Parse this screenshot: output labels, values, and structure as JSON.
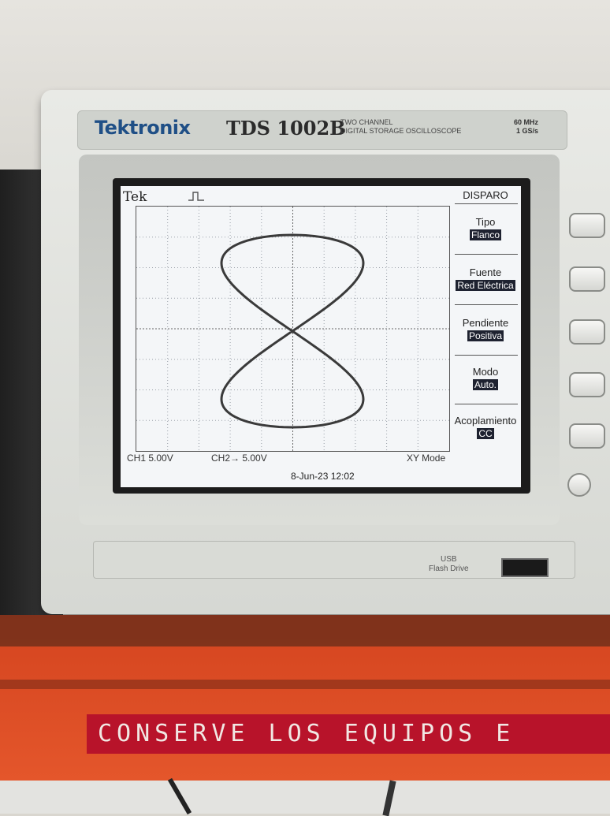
{
  "device": {
    "brand": "Tektronix",
    "model": "TDS 1002B",
    "description_line1": "TWO CHANNEL",
    "description_line2": "DIGITAL STORAGE OSCILLOSCOPE",
    "bandwidth": "60 MHz",
    "sample_rate": "1 GS/s"
  },
  "screen": {
    "logo": "Tek",
    "ch1_readout": "CH1  5.00V",
    "ch2_readout": "CH2→ 5.00V",
    "mode": "XY Mode",
    "timestamp": "8-Jun-23 12:02",
    "trace_shape": "figure-eight (Lissajous 1:2)"
  },
  "menu": {
    "title": "DISPARO",
    "items": [
      {
        "label": "Tipo",
        "value": "Flanco"
      },
      {
        "label": "Fuente",
        "value": "Red Eléctrica"
      },
      {
        "label": "Pendiente",
        "value": "Positiva"
      },
      {
        "label": "Modo",
        "value": "Auto."
      },
      {
        "label": "Acoplamiento",
        "value": "CC"
      }
    ]
  },
  "panel": {
    "usb_line1": "USB",
    "usb_line2": "Flash Drive"
  },
  "shelf": {
    "label_text": "CONSERVE LOS EQUIPOS E"
  },
  "colors": {
    "brand_blue": "#1f4f86",
    "screen_bg": "#f4f6f8",
    "trace": "#3a3a3a",
    "shelf_orange": "#e4562b",
    "label_red": "#b8132a"
  }
}
